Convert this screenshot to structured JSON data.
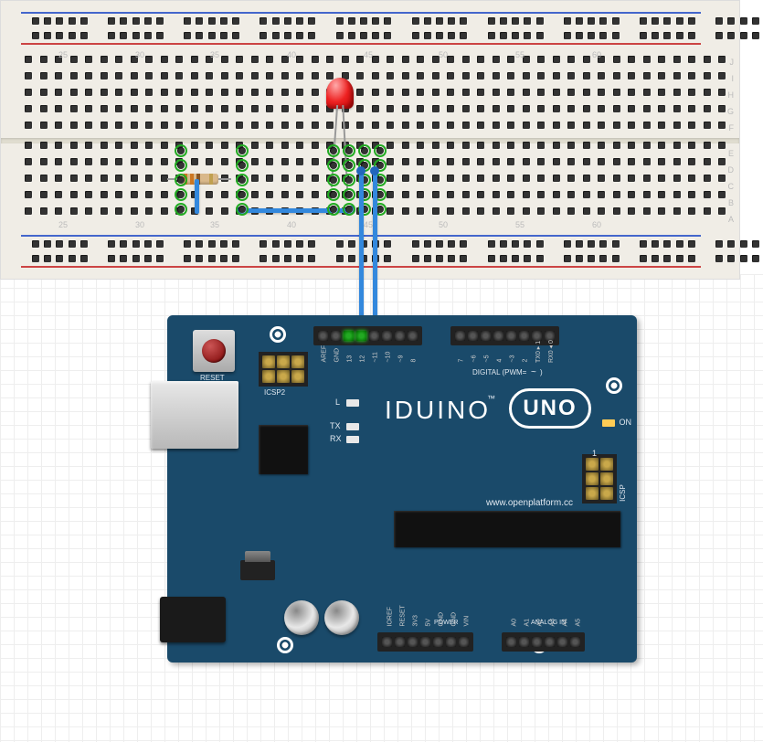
{
  "board": {
    "brand": "IDUINO",
    "model": "UNO",
    "url": "www.openplatform.cc",
    "reset_label": "RESET",
    "icsp2_label": "ICSP2",
    "icsp_label": "ICSP",
    "digital_section": "DIGITAL (PWM=",
    "power_section": "POWER",
    "analog_section": "ANALOG IN",
    "on_label": "ON",
    "leds": {
      "l": "L",
      "tx": "TX",
      "rx": "RX"
    },
    "tm_symbol": "™",
    "one_label": "1",
    "digital_pins_upper": [
      "AREF",
      "GND",
      "13",
      "12",
      "~11",
      "~10",
      "~9",
      "8"
    ],
    "digital_pins_lower": [
      "7",
      "~6",
      "~5",
      "4",
      "~3",
      "2",
      "TX0 ▸ 1",
      "RX0 ◂ 0"
    ],
    "power_pins": [
      "IOREF",
      "RESET",
      "3V3",
      "5V",
      "GND",
      "GND",
      "VIN"
    ],
    "analog_pins": [
      "A0",
      "A1",
      "A2",
      "A3",
      "A4",
      "A5"
    ],
    "wave_symbol": "~"
  },
  "breadboard": {
    "col_numbers": [
      "25",
      "30",
      "35",
      "40",
      "45",
      "50",
      "55",
      "60"
    ],
    "row_letters_top": [
      "J",
      "I",
      "H",
      "G",
      "F"
    ],
    "row_letters_bottom": [
      "E",
      "D",
      "C",
      "B",
      "A"
    ]
  },
  "circuit": {
    "components": [
      "red-led",
      "330-ohm-resistor",
      "jumper-wire-blue-1",
      "jumper-wire-blue-2",
      "jumper-wire-blue-3"
    ],
    "connections": {
      "led_anode_pin": "12",
      "led_cathode_pin": "13",
      "resistor_purpose": "current-limiting"
    }
  }
}
